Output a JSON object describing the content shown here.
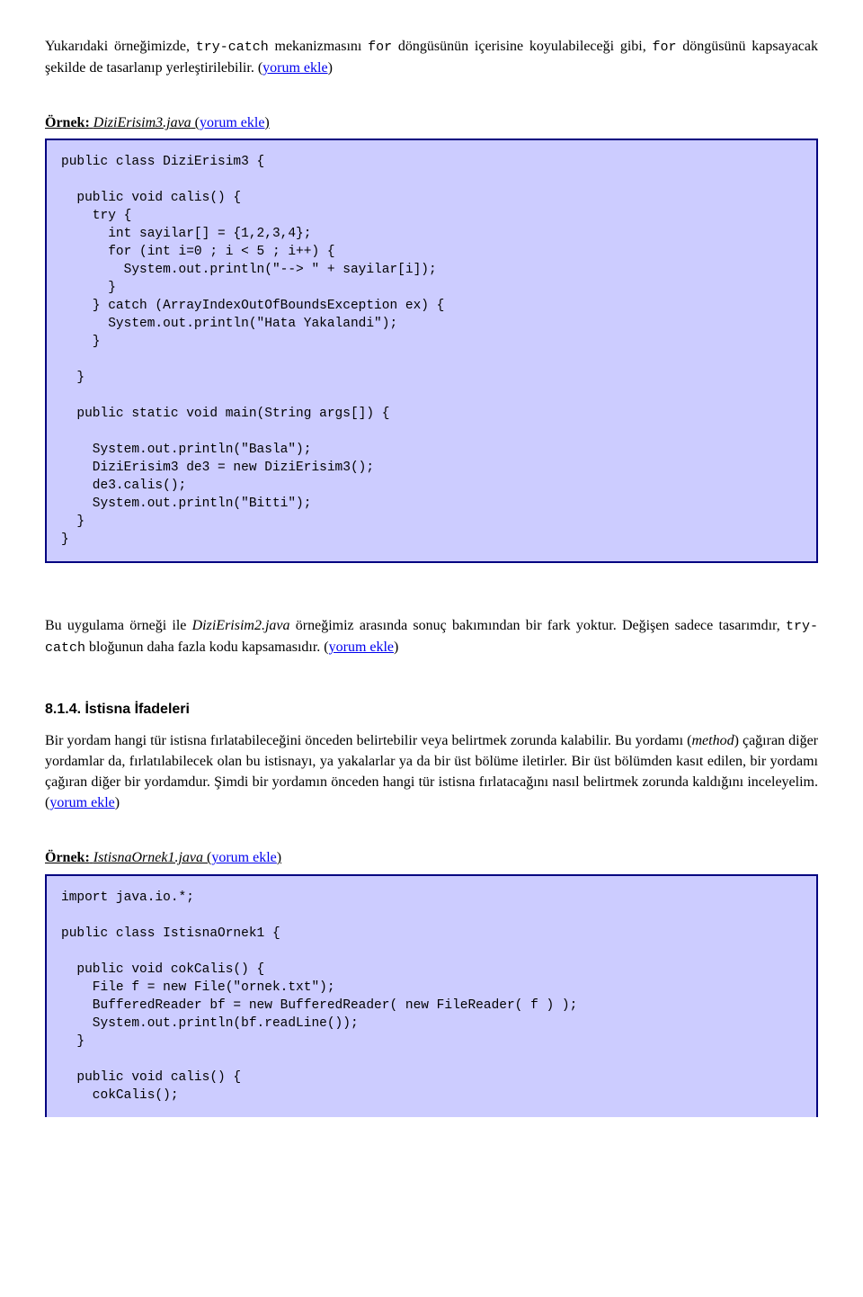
{
  "para1": {
    "a": "Yukarıdaki örneğimizde, ",
    "mono1": "try-catch",
    "b": " mekanizmasını ",
    "mono2": "for",
    "c": " döngüsünün içerisine koyulabileceği gibi, ",
    "mono3": "for",
    "d": " döngüsünü kapsayacak şekilde de tasarlanıp yerleştirilebilir. (",
    "link": "yorum ekle",
    "e": ")"
  },
  "example1": {
    "label": "Örnek:",
    "filename": "DiziErisim3.java",
    "open": " (",
    "link": "yorum ekle",
    "close": ")"
  },
  "code1": "public class DiziErisim3 {\n\n  public void calis() {\n    try {\n      int sayilar[] = {1,2,3,4};\n      for (int i=0 ; i < 5 ; i++) {\n        System.out.println(\"--> \" + sayilar[i]);\n      }\n    } catch (ArrayIndexOutOfBoundsException ex) {\n      System.out.println(\"Hata Yakalandi\");\n    }\n\n  }\n\n  public static void main(String args[]) {\n\n    System.out.println(\"Basla\");\n    DiziErisim3 de3 = new DiziErisim3();\n    de3.calis();\n    System.out.println(\"Bitti\");\n  }\n}",
  "para2": {
    "a": "Bu uygulama örneği ile ",
    "i1": "DiziErisim2.java",
    "b": " örneğimiz arasında sonuç bakımından bir fark yoktur. Değişen sadece tasarımdır, ",
    "mono1": "try-catch",
    "c": " bloğunun daha fazla kodu kapsamasıdır. (",
    "link": "yorum ekle",
    "d": ")"
  },
  "section": "8.1.4. İstisna İfadeleri",
  "para3": {
    "a": "Bir yordam hangi tür istisna fırlatabileceğini önceden belirtebilir veya belirtmek zorunda kalabilir. Bu yordamı (",
    "i1": "method",
    "b": ") çağıran diğer yordamlar da, fırlatılabilecek olan bu istisnayı, ya yakalarlar ya da bir üst bölüme iletirler. Bir üst bölümden kasıt edilen, bir yordamı çağıran diğer bir yordamdur. Şimdi bir yordamın önceden hangi tür istisna fırlatacağını nasıl belirtmek zorunda kaldığını inceleyelim. (",
    "link": "yorum ekle",
    "c": ")"
  },
  "example2": {
    "label": "Örnek:",
    "filename": "IstisnaOrnek1.java",
    "open": " (",
    "link": "yorum ekle",
    "close": ")"
  },
  "code2": "import java.io.*;\n\npublic class IstisnaOrnek1 {\n\n  public void cokCalis() {\n    File f = new File(\"ornek.txt\");\n    BufferedReader bf = new BufferedReader( new FileReader( f ) );\n    System.out.println(bf.readLine());\n  }\n\n  public void calis() {\n    cokCalis();"
}
